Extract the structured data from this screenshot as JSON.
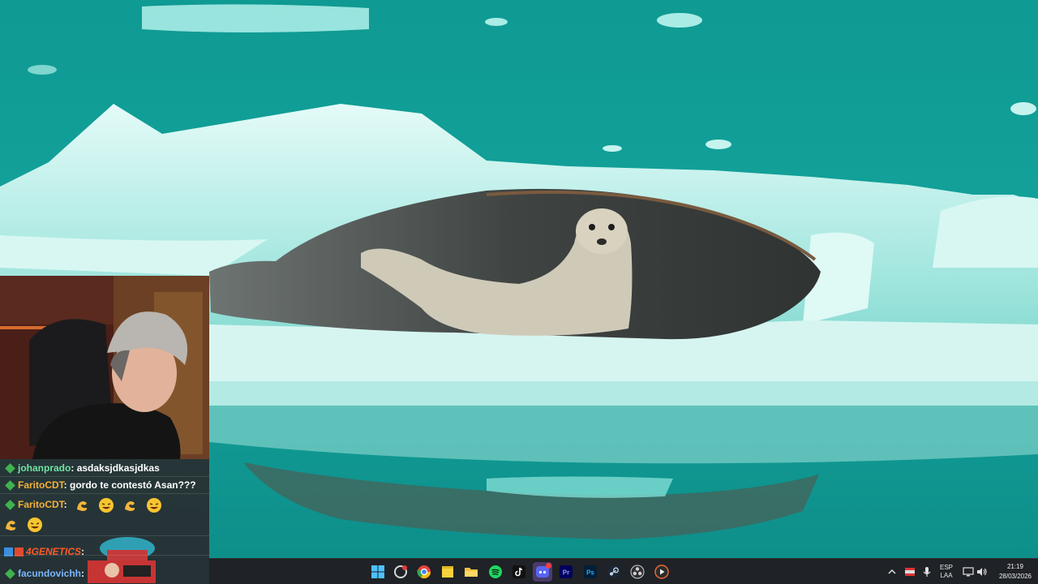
{
  "chat": {
    "messages": [
      {
        "user": "johanprado",
        "text": "asdaksjdkasjdkas"
      },
      {
        "user": "FaritoCDT",
        "text": "gordo te contestó Asan???"
      },
      {
        "user": "FaritoCDT",
        "text": ""
      },
      {
        "user": "4GENETICS",
        "text": ""
      },
      {
        "user": "facundovichh",
        "text": ""
      }
    ]
  },
  "taskbar": {
    "apps": [
      "start-icon",
      "snipping-tool-icon",
      "chrome-icon",
      "sticky-notes-icon",
      "file-explorer-icon",
      "spotify-icon",
      "tiktok-icon",
      "discord-icon",
      "premiere-icon",
      "photoshop-icon",
      "steam-icon",
      "obs-icon",
      "media-player-icon"
    ],
    "active_app": "discord-icon"
  },
  "tray": {
    "language": "ESP",
    "layout": "LAA",
    "time": "21:19",
    "date": "28/03/2026"
  },
  "colors": {
    "water": "#0f8c88",
    "ice": "#bff0ec",
    "taskbar": "#1f2226",
    "chat_bg": "#2a2e33"
  }
}
